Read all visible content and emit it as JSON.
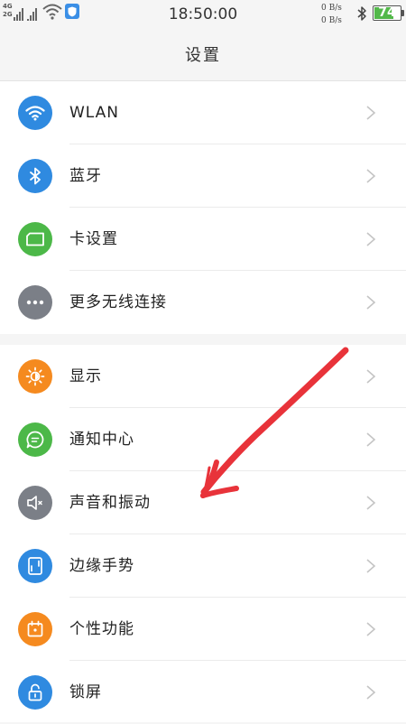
{
  "status_bar": {
    "network_top": "4G",
    "network_bottom": "2G",
    "time": "18:50:00",
    "upload_speed": "0 B/s",
    "download_speed": "0 B/s",
    "battery_level": "74",
    "battery_fraction": 0.74,
    "icons": [
      "signal-icon",
      "wifi-icon",
      "shield-icon",
      "bluetooth-icon",
      "battery-icon"
    ]
  },
  "header": {
    "title": "设置"
  },
  "settings_group_1": [
    {
      "label": "WLAN",
      "icon": "wifi-icon",
      "color": "#2f8ae0"
    },
    {
      "label": "蓝牙",
      "icon": "bluetooth-icon",
      "color": "#2f8ae0"
    },
    {
      "label": "卡设置",
      "icon": "sim-card-icon",
      "color": "#4cb848"
    },
    {
      "label": "更多无线连接",
      "icon": "more-icon",
      "color": "#7b7f87"
    }
  ],
  "settings_group_2": [
    {
      "label": "显示",
      "icon": "brightness-icon",
      "color": "#f58a1f"
    },
    {
      "label": "通知中心",
      "icon": "message-icon",
      "color": "#4cb848"
    },
    {
      "label": "声音和振动",
      "icon": "speaker-icon",
      "color": "#7b7f87"
    },
    {
      "label": "边缘手势",
      "icon": "edge-gesture-icon",
      "color": "#2f8ae0"
    },
    {
      "label": "个性功能",
      "icon": "calendar-icon",
      "color": "#f58a1f"
    },
    {
      "label": "锁屏",
      "icon": "lock-icon",
      "color": "#2f8ae0"
    }
  ],
  "annotation": {
    "color": "#e8333a",
    "points_to": "声音和振动"
  }
}
